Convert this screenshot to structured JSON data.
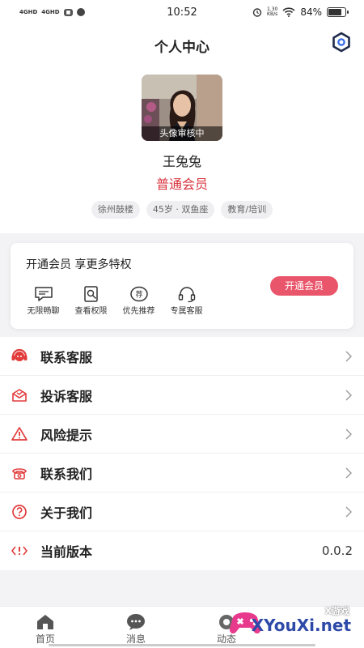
{
  "status_bar": {
    "signal_1": "4GHD",
    "signal_2": "4GHD",
    "time": "10:52",
    "speed_value": "1.30",
    "speed_unit": "KB/s",
    "battery": "84%",
    "battery_level": 0.84
  },
  "header": {
    "title": "个人中心",
    "settings_icon": "hexagon-gear-icon"
  },
  "profile": {
    "avatar_badge": "头像审核中",
    "nickname": "王兔兔",
    "member_level": "普通会员",
    "tags": [
      "徐州鼓楼",
      "45岁 · 双鱼座",
      "教育/培训"
    ]
  },
  "vip_card": {
    "title": "开通会员 享更多特权",
    "perks": [
      {
        "label": "无限畅聊",
        "icon": "chat-icon"
      },
      {
        "label": "查看权限",
        "icon": "view-permission-icon"
      },
      {
        "label": "优先推荐",
        "icon": "recommend-icon"
      },
      {
        "label": "专属客服",
        "icon": "headset-icon"
      }
    ],
    "button_label": "开通会员"
  },
  "menu": {
    "items": [
      {
        "label": "联系客服",
        "icon": "customer-service-icon"
      },
      {
        "label": "投诉客服",
        "icon": "complaint-icon"
      },
      {
        "label": "风险提示",
        "icon": "warning-icon"
      },
      {
        "label": "联系我们",
        "icon": "phone-icon"
      },
      {
        "label": "关于我们",
        "icon": "question-icon"
      },
      {
        "label": "当前版本",
        "icon": "version-icon",
        "value": "0.0.2"
      }
    ]
  },
  "tab_bar": {
    "tabs": [
      {
        "label": "首页",
        "icon": "home-icon"
      },
      {
        "label": "消息",
        "icon": "message-icon"
      },
      {
        "label": "动态",
        "icon": "moments-icon"
      }
    ]
  },
  "watermark": {
    "small_text": "X游戏",
    "text": "XYouXi.net"
  },
  "colors": {
    "accent_red": "#d8313c",
    "vip_button": "#e9556a"
  }
}
